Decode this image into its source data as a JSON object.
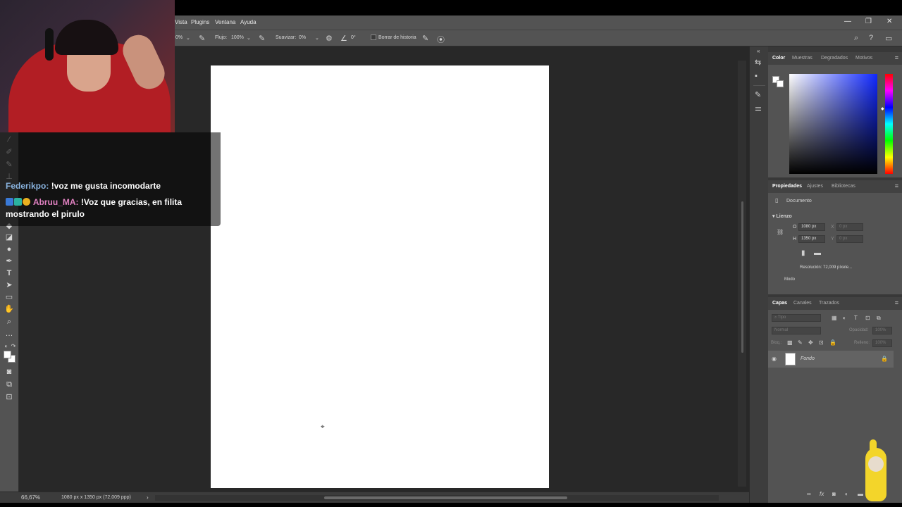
{
  "menubar": {
    "items": [
      "Vista",
      "Plugins",
      "Ventana",
      "Ayuda"
    ],
    "window_controls": {
      "minimize": "—",
      "restore": "❐",
      "close": "✕"
    }
  },
  "options_bar": {
    "opacity_value": "0%",
    "flow_label": "Flujo:",
    "flow_value": "100%",
    "smoothing_label": "Suavizar:",
    "smoothing_value": "0%",
    "angle_value": "0°",
    "erase_history_label": "Borrar de historia"
  },
  "chat": {
    "messages": [
      {
        "user": "Federikpo:",
        "text": "!voz me gusta incomodarte"
      },
      {
        "user": "Abruu_MA:",
        "text": "!Voz que gracias, en filita mostrando el pirulo"
      }
    ]
  },
  "status_bar": {
    "zoom": "66,67%",
    "doc_info": "1080 px x 1350 px (72,009 ppp)"
  },
  "color_panel": {
    "tabs": [
      "Color",
      "Muestras",
      "Degradados",
      "Motivos"
    ],
    "active_tab": "Color",
    "colors": {
      "foreground": "#ffffff",
      "background": "#ffffff",
      "field_hue": "#1028ff"
    }
  },
  "properties_panel": {
    "tabs": [
      "Propiedades",
      "Ajustes",
      "Bibliotecas"
    ],
    "active_tab": "Propiedades",
    "doc_label": "Documento",
    "section": "Lienzo",
    "width_label": "O",
    "width_value": "1080 px",
    "height_label": "H",
    "height_value": "1350 px",
    "x_label": "X",
    "x_value": "0 px",
    "y_label": "Y",
    "y_value": "0 px",
    "resolution": "Resolución: 72,009 píxele...",
    "mode_label": "Modo"
  },
  "layers_panel": {
    "tabs": [
      "Capas",
      "Canales",
      "Trazados"
    ],
    "active_tab": "Capas",
    "search_placeholder": "Tipo",
    "blend_mode": "Normal",
    "opacity_label": "Opacidad:",
    "opacity_value": "100%",
    "lock_label": "Bloq.:",
    "fill_label": "Relleno:",
    "fill_value": "100%",
    "layers": [
      {
        "name": "Fondo",
        "visible": true,
        "locked": true
      }
    ]
  },
  "icons": {
    "tools": [
      "eyedropper-icon",
      "healing-brush-icon",
      "brush-icon",
      "clone-stamp-icon",
      "eraser-icon",
      "gradient-icon",
      "dodge-icon",
      "pen-icon",
      "type-icon",
      "path-select-icon",
      "rectangle-icon",
      "hand-icon",
      "zoom-icon",
      "more-tools-icon"
    ]
  }
}
